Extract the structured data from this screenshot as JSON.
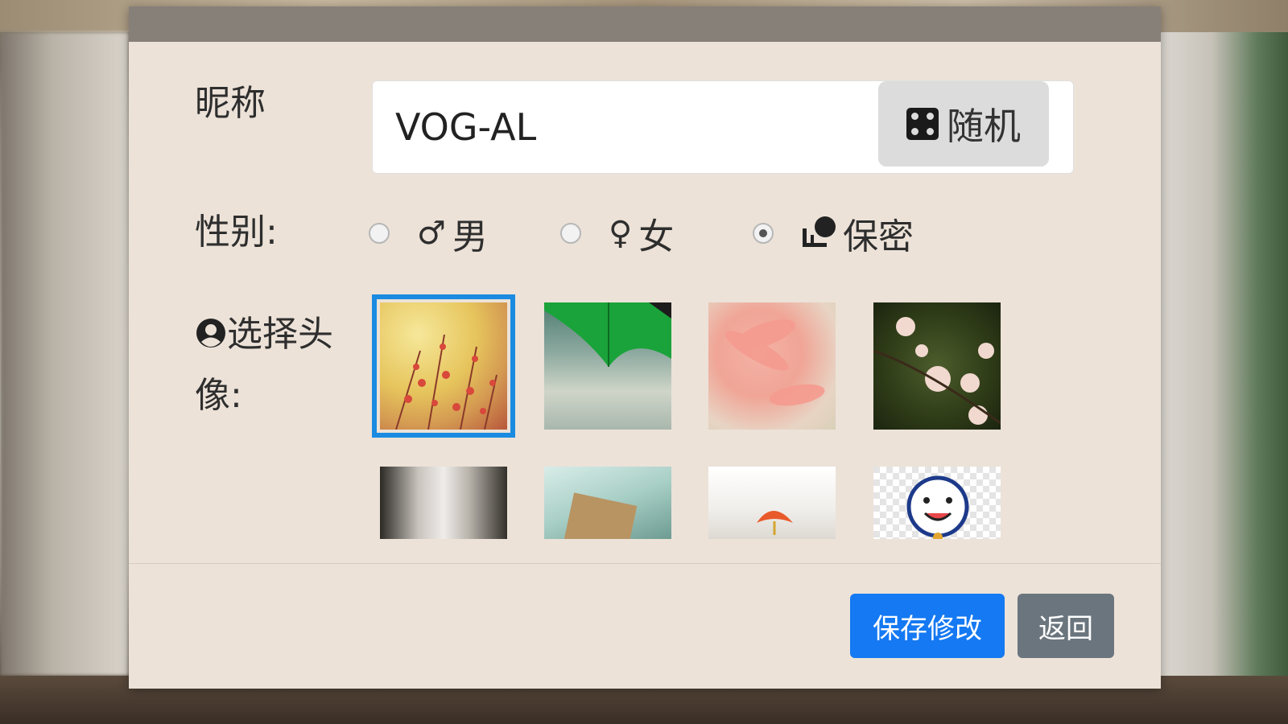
{
  "form": {
    "nickname_label": "昵称",
    "nickname_value": "VOG-AL",
    "random_button": "随机",
    "gender_label": "性别:",
    "gender_options": [
      {
        "symbol": "♂",
        "label": "男",
        "checked": false
      },
      {
        "symbol": "♀",
        "label": "女",
        "checked": false
      },
      {
        "symbol": "icon",
        "label": "保密",
        "checked": true
      }
    ],
    "avatar_label": "选择头像:",
    "selected_avatar": 0,
    "avatar_count": 8
  },
  "footer": {
    "save_button": "保存修改",
    "back_button": "返回"
  },
  "colors": {
    "primary": "#1479f2",
    "secondary": "#6b757d",
    "selected_outline": "#1a8be0",
    "dialog_bg": "#ece2d8",
    "header_bar": "#878079"
  }
}
